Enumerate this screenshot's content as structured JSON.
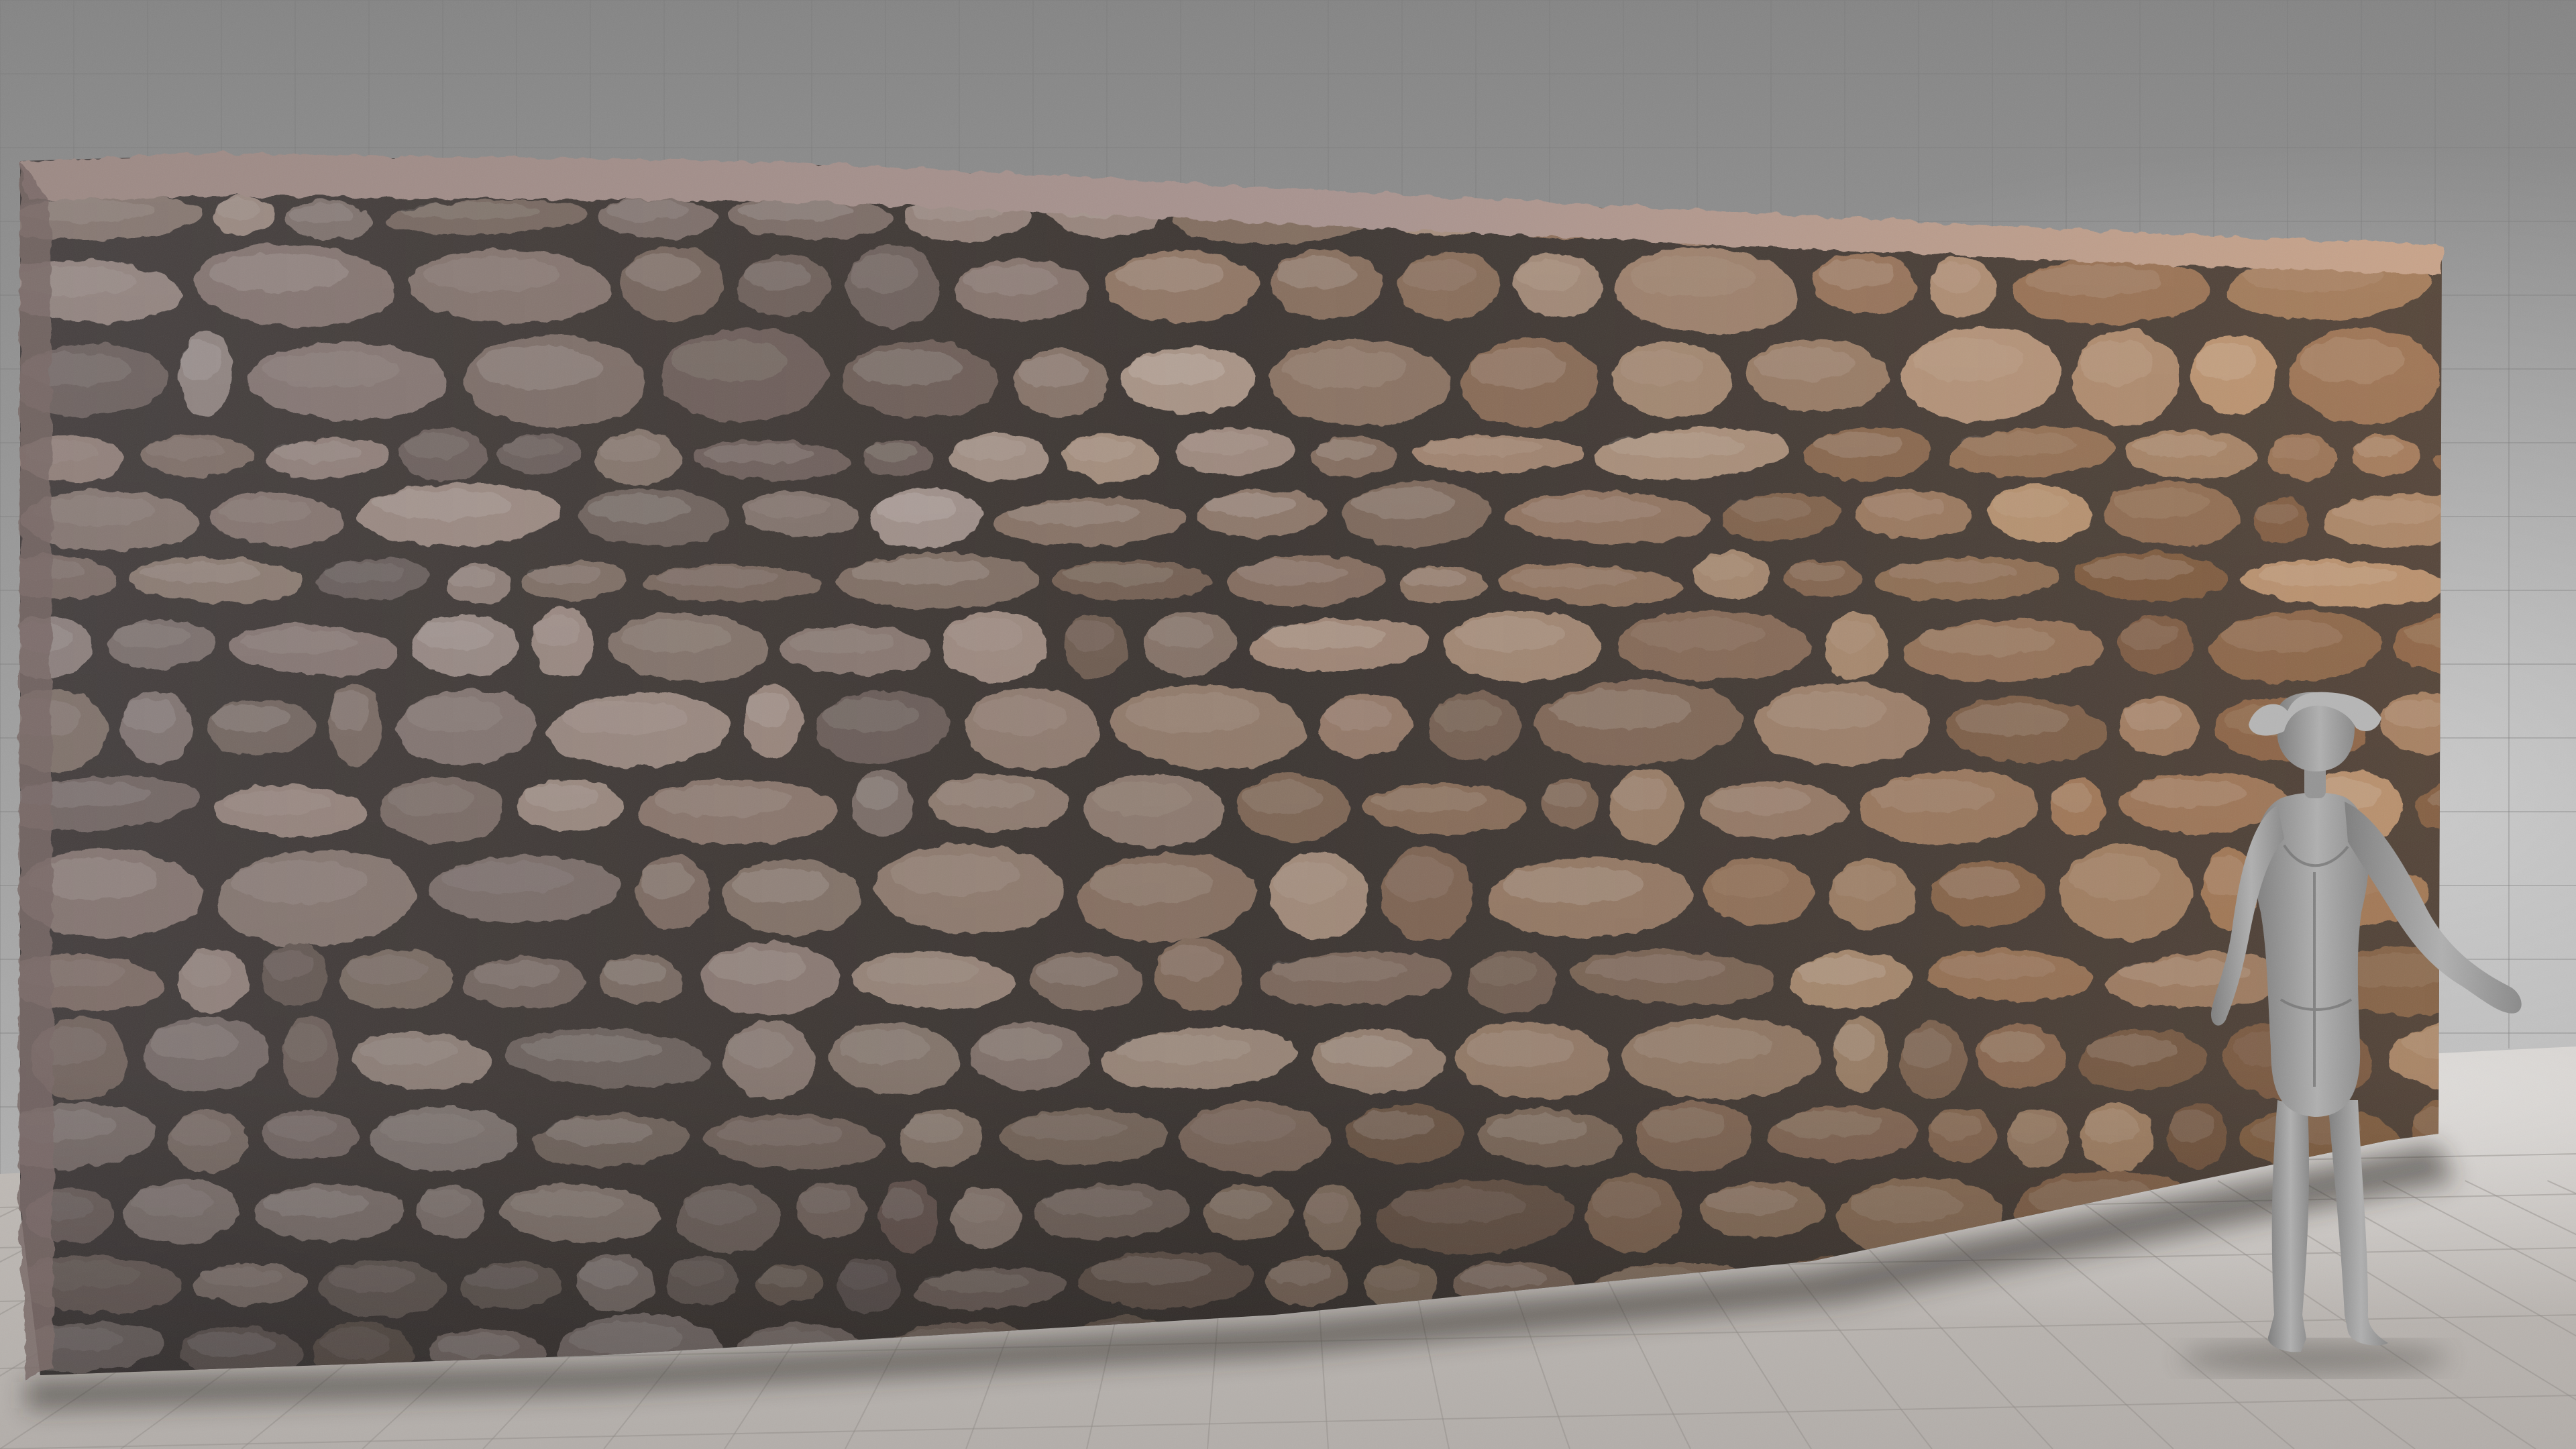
{
  "scene": {
    "subject": "stone-wall",
    "reference_figure": "mannequin",
    "colors": {
      "background_wall": "#8e8e8e",
      "background_wall_light": "#b4b4b4",
      "floor": "#c9c4bf",
      "floor_light": "#ddd9d5",
      "grid_line": "#7a7a7a",
      "mortar": "#3d3734",
      "mortar_light": "#5a504b",
      "stone_cool": [
        "#8d7f7b",
        "#9c8f8b",
        "#7c706c",
        "#a69894",
        "#857873",
        "#6d625f"
      ],
      "stone_warm": [
        "#9a7356",
        "#b08a6a",
        "#8a6446",
        "#c09a78",
        "#a67c5b",
        "#7a583e"
      ],
      "wall_top": "#a8918a",
      "wall_top_warm": "#c09f88",
      "mannequin": "#a3a3a3",
      "mannequin_shade": "#7d7d7d",
      "mannequin_light": "#c2c2c2"
    }
  }
}
